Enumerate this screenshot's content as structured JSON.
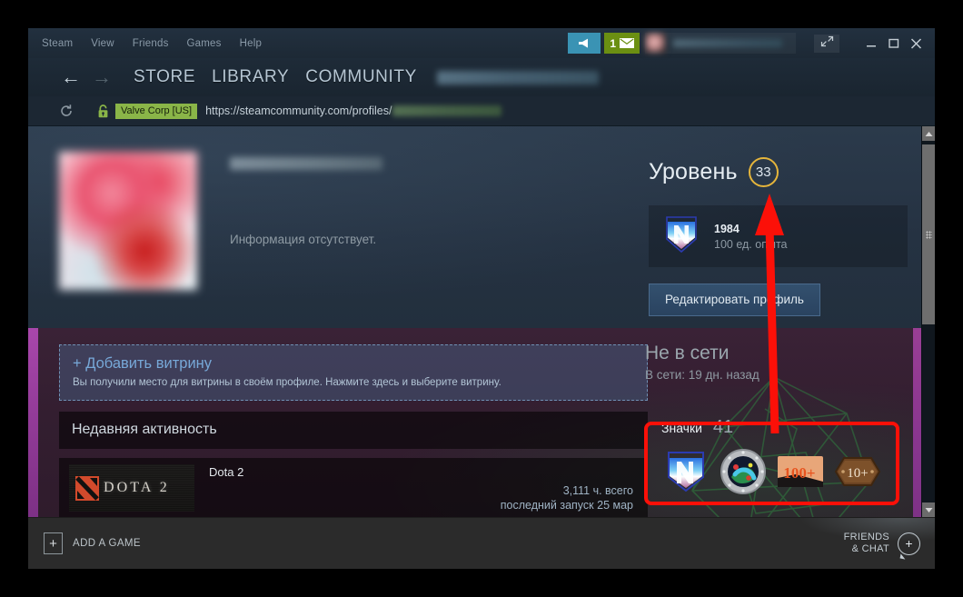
{
  "window": {
    "menu": [
      "Steam",
      "View",
      "Friends",
      "Games",
      "Help"
    ],
    "notification_count": "1",
    "icons": {
      "broadcast": "broadcast-icon",
      "envelope": "envelope-icon",
      "fullscreen": "fullscreen-icon",
      "minimize": "minimize-icon",
      "maximize": "maximize-icon",
      "close": "close-icon"
    }
  },
  "nav": {
    "back": "←",
    "forward": "→",
    "links": [
      "STORE",
      "LIBRARY",
      "COMMUNITY"
    ]
  },
  "urlbar": {
    "reload": "⟳",
    "cert_label": "Valve Corp [US]",
    "url": "https://steamcommunity.com/profiles/"
  },
  "profile": {
    "summary_empty": "Информация отсутствует.",
    "level_label": "Уровень",
    "level_value": "33",
    "featured_badge": {
      "title": "1984",
      "xp": "100 ед. опыта"
    },
    "edit_button": "Редактировать профиль"
  },
  "showcase": {
    "title": "+ Добавить витрину",
    "subtitle": "Вы получили место для витрины в своём профиле. Нажмите здесь и выберите витрину."
  },
  "activity": {
    "header": "Недавняя активность",
    "games": [
      {
        "name": "Dota 2",
        "cover_text": "DOTA 2",
        "hours": "3,111 ч. всего",
        "last_played": "последний запуск 25 мар"
      }
    ]
  },
  "status": {
    "state": "Не в сети",
    "last_online": "В сети: 19 дн. назад"
  },
  "badges": {
    "label": "Значки",
    "count": "41",
    "items": [
      {
        "name": "badge-n-shield",
        "text": ""
      },
      {
        "name": "badge-porthole",
        "text": ""
      },
      {
        "name": "badge-100-plus",
        "text": "100+"
      },
      {
        "name": "badge-10-plus",
        "text": "10+"
      }
    ]
  },
  "bottombar": {
    "add_game": "ADD A GAME",
    "add_game_plus": "+",
    "friends_line1": "FRIENDS",
    "friends_line2": "& CHAT",
    "friends_plus": "+"
  },
  "annotation": {
    "color": "#fc1008",
    "description": "red arrow from badges box to level circle"
  }
}
